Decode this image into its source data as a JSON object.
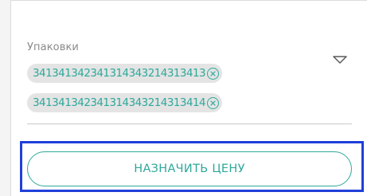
{
  "packages": {
    "label": "Упаковки",
    "items": [
      {
        "code": "341341342341314343214313413"
      },
      {
        "code": "341341342341314343214313414"
      }
    ],
    "remove_icon": "close-circle-icon",
    "dropdown_icon": "triangle-down-outline-icon"
  },
  "actions": {
    "assign_price_label": "НАЗНАЧИТЬ ЦЕНУ"
  },
  "colors": {
    "accent": "#2fa89b",
    "chip_background": "#e4e4e4",
    "highlight_border": "#1f3fd9",
    "label_text": "#8a8a8a"
  }
}
